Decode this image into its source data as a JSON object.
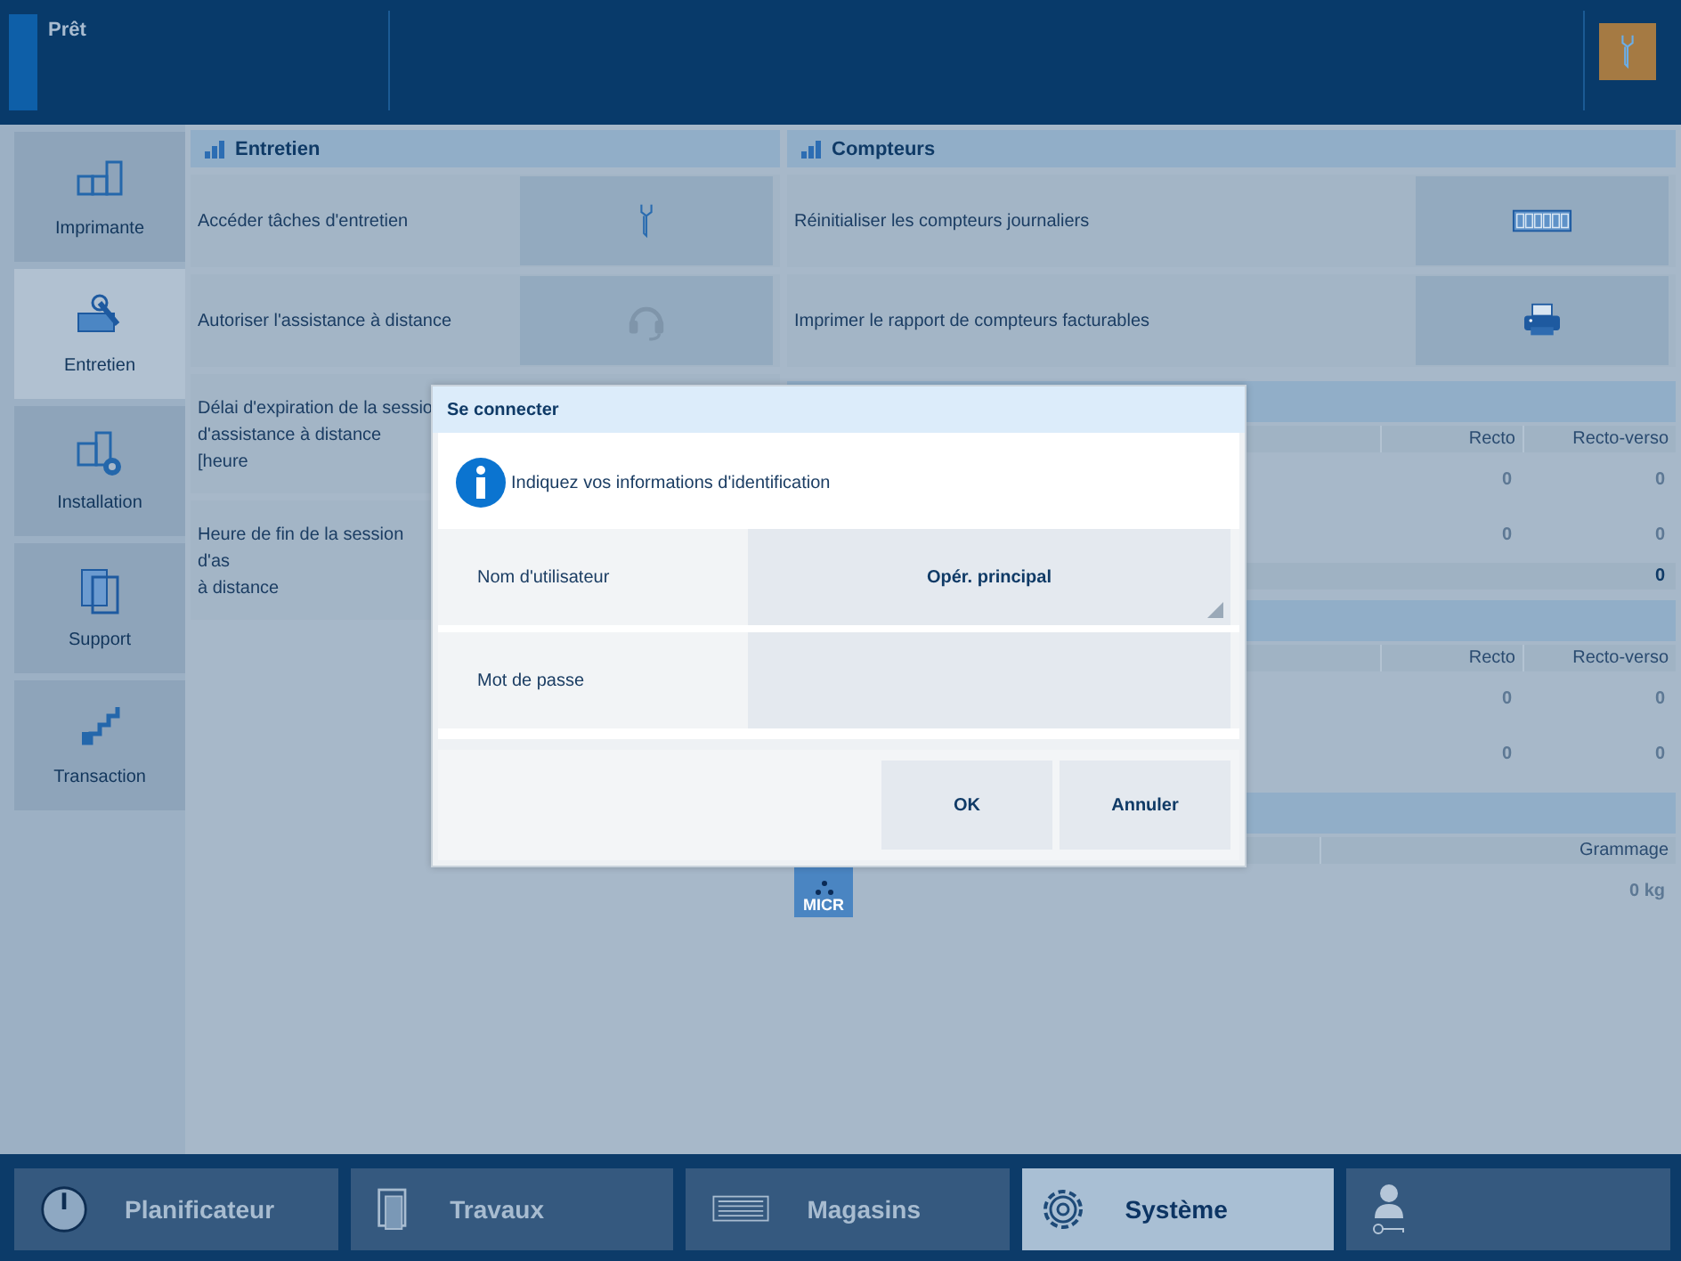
{
  "status_bar": {
    "text": "Prêt"
  },
  "sidebar": {
    "items": [
      {
        "label": "Imprimante",
        "selected": false
      },
      {
        "label": "Entretien",
        "selected": true
      },
      {
        "label": "Installation",
        "selected": false
      },
      {
        "label": "Support",
        "selected": false
      },
      {
        "label": "Transaction",
        "selected": false
      }
    ]
  },
  "maintenance": {
    "title": "Entretien",
    "rows": [
      {
        "label": "Accéder tâches d'entretien",
        "kind": "action"
      },
      {
        "label": "Autoriser l'assistance à distance",
        "kind": "action"
      },
      {
        "label": "Délai d'expiration de la sessio\nd'assistance à distance [heure",
        "kind": "text"
      },
      {
        "label": "Heure de fin de la session d'as\nà distance",
        "kind": "text"
      }
    ]
  },
  "counters": {
    "title": "Compteurs",
    "rows": [
      {
        "label": "Réinitialiser les compteurs journaliers",
        "kind": "action"
      },
      {
        "label": "Imprimer le rapport de compteurs facturables",
        "kind": "action"
      }
    ],
    "tables": [
      {
        "columns": [
          "Recto",
          "Recto-verso"
        ],
        "rows": [
          [
            "0",
            "0"
          ],
          [
            "0",
            "0"
          ]
        ],
        "total": "0"
      },
      {
        "columns": [
          "Recto",
          "Recto-verso"
        ],
        "rows": [
          [
            "0",
            "0"
          ],
          [
            "0",
            "0"
          ]
        ]
      },
      {
        "columns": [
          "Grammage"
        ],
        "rows": [
          [
            "0 kg"
          ]
        ],
        "badge": "MICR"
      }
    ]
  },
  "dialog": {
    "title": "Se connecter",
    "message": "Indiquez vos informations d'identification",
    "fields": [
      {
        "label": "Nom d'utilisateur",
        "value": "Opér. principal",
        "kind": "dropdown"
      },
      {
        "label": "Mot de passe",
        "kind": "password"
      }
    ],
    "buttons": [
      "OK",
      "Annuler"
    ]
  },
  "tabs": [
    {
      "label": "Planificateur",
      "selected": false
    },
    {
      "label": "Travaux",
      "selected": false
    },
    {
      "label": "Magasins",
      "selected": false
    },
    {
      "label": "Système",
      "selected": true
    },
    {
      "selected": false
    }
  ]
}
